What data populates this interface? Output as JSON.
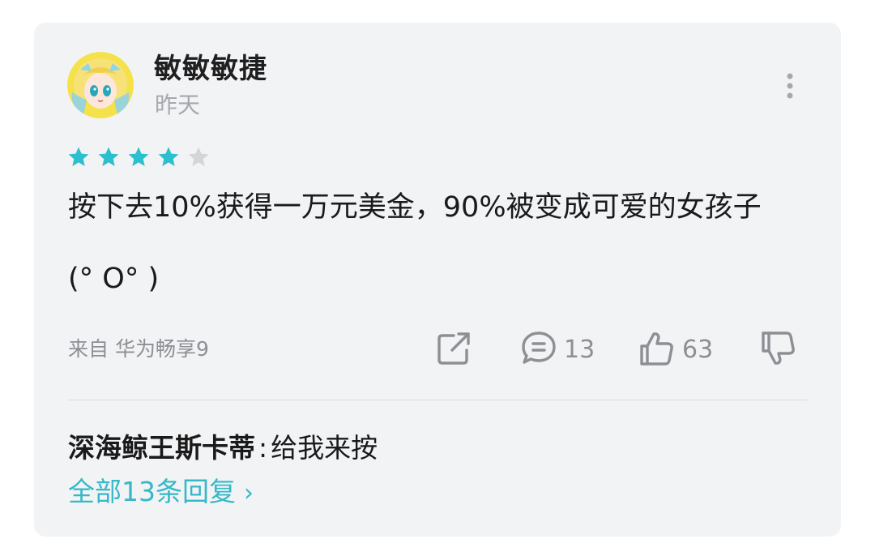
{
  "comment": {
    "user": {
      "name": "敏敏敏捷",
      "time": "昨天",
      "avatar": "anime-girl-avatar"
    },
    "rating": {
      "value": 4,
      "max": 5
    },
    "text_line1": "按下去10%获得一万元美金，90%被变成可爱的女孩子",
    "text_line2": "(° O° )",
    "source": "来自 华为畅享9",
    "actions": {
      "share_icon": "share-icon",
      "comment_icon": "comment-icon",
      "comment_count": "13",
      "like_icon": "thumbs-up-icon",
      "like_count": "63",
      "dislike_icon": "thumbs-down-icon"
    },
    "reply": {
      "author": "深海鲸王斯卡蒂",
      "separator": ":",
      "text": "给我来按"
    },
    "all_replies_label": "全部13条回复",
    "chevron": "›"
  },
  "colors": {
    "accent": "#35b8c8",
    "star_filled": "#2bbfd0",
    "star_empty": "#d3d5d8",
    "card_bg": "#f2f3f5",
    "muted_text": "#8c8f94"
  }
}
